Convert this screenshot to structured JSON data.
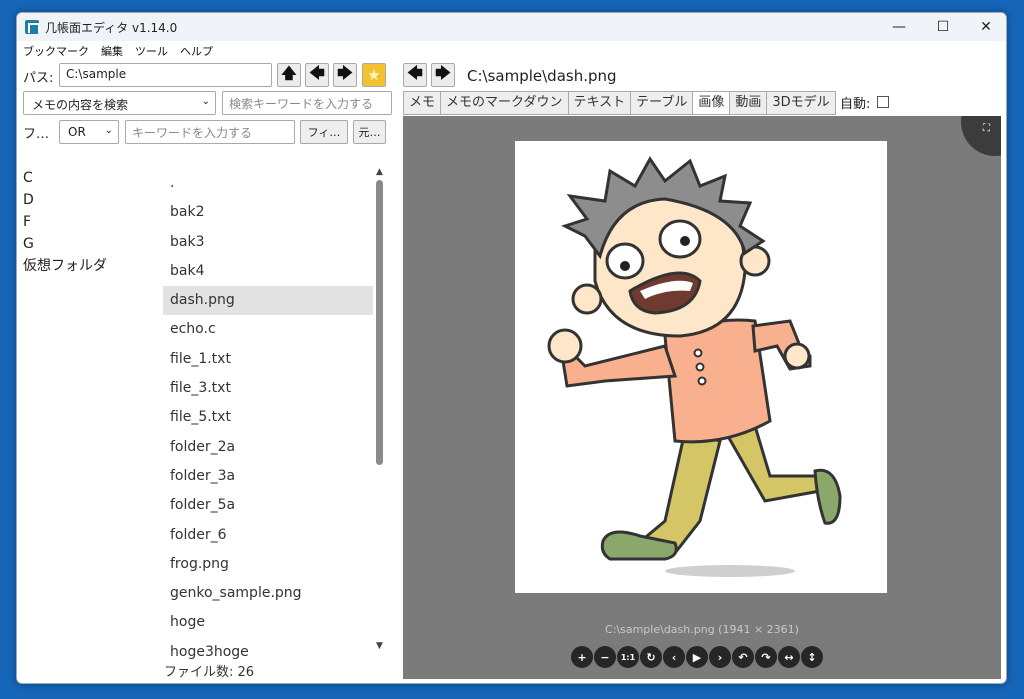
{
  "window": {
    "title": "几帳面エディタ v1.14.0"
  },
  "menu": [
    "ブックマーク",
    "編集",
    "ツール",
    "ヘルプ"
  ],
  "left": {
    "path_label": "パス:",
    "path_value": "C:\\sample",
    "search_scope": "メモの内容を検索",
    "search_placeholder": "検索キーワードを入力する",
    "filter_label": "フ…",
    "filter_mode": "OR",
    "keyword_placeholder": "キーワードを入力する",
    "filter_button": "フィ…",
    "reset_button": "元…",
    "drives": [
      "C",
      "D",
      "F",
      "G",
      "仮想フォルダ"
    ],
    "files": [
      ".",
      "bak2",
      "bak3",
      "bak4",
      "dash.png",
      "echo.c",
      "file_1.txt",
      "file_3.txt",
      "file_5.txt",
      "folder_2a",
      "folder_3a",
      "folder_5a",
      "folder_6",
      "frog.png",
      "genko_sample.png",
      "hoge",
      "hoge3hoge"
    ],
    "selected_file": "dash.png",
    "file_count": "ファイル数: 26"
  },
  "right": {
    "path": "C:\\sample\\dash.png",
    "tabs": [
      "メモ",
      "メモのマークダウン",
      "テキスト",
      "テーブル",
      "画像",
      "動画",
      "3Dモデル"
    ],
    "active_tab": "画像",
    "auto_label": "自動:",
    "caption": "C:\\sample\\dash.png (1941 × 2361)",
    "controls": [
      "+",
      "−",
      "1:1",
      "↻",
      "‹",
      "▶",
      "›",
      "↶",
      "↷",
      "↔",
      "↕"
    ]
  },
  "colors": {
    "accent": "#1565b8",
    "star": "#f2c230",
    "viewer_bg": "#7b7b7b",
    "selected_row": "#e2e2e2"
  }
}
